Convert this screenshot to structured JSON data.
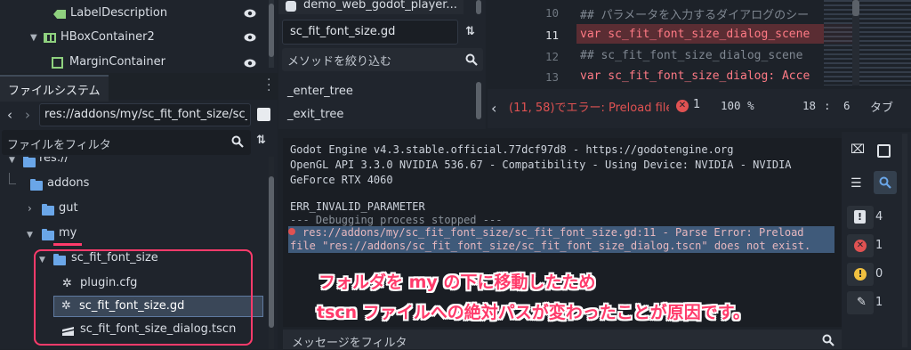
{
  "scene_tree": {
    "rows": [
      {
        "label": "LabelDescription"
      },
      {
        "label": "HBoxContainer2"
      },
      {
        "label": "MarginContainer"
      }
    ]
  },
  "filesystem": {
    "tab_label": "ファイルシステム",
    "path": "res://addons/my/sc_fit_font_size/sc_",
    "filter_placeholder": "ファイルをフィルタ",
    "tree": [
      {
        "label": "res://"
      },
      {
        "label": "addons"
      },
      {
        "label": "gut"
      },
      {
        "label": "my"
      },
      {
        "label": "sc_fit_font_size"
      },
      {
        "label": "plugin.cfg"
      },
      {
        "label": "sc_fit_font_size.gd"
      },
      {
        "label": "sc_fit_font_size_dialog.tscn"
      }
    ]
  },
  "script_list": {
    "top_item": "demo_web_godot_player...",
    "current_script": "sc_fit_font_size.gd",
    "method_filter_placeholder": "メソッドを絞り込む",
    "methods": [
      "_enter_tree",
      "_exit_tree"
    ]
  },
  "editor": {
    "lines": [
      {
        "num": "10",
        "text": "## パラメータを入力するダイアログのシー"
      },
      {
        "num": "11",
        "text": "var sc_fit_font_size_dialog_scene"
      },
      {
        "num": "12",
        "text": "## sc_fit_font_size_dialog_scene"
      },
      {
        "num": "13",
        "text": "var sc_fit_font_size_dialog: Acce"
      }
    ],
    "status": {
      "error_text": "(11, 58)でエラー: Preload file",
      "error_count": "1",
      "zoom": "100 %",
      "line": "18",
      "col": "6",
      "indent": "タブ"
    }
  },
  "output": {
    "lines": [
      "Godot Engine v4.3.stable.official.77dcf97d8 - https://godotengine.org",
      "OpenGL API 3.3.0 NVIDIA 536.67 - Compatibility - Using Device: NVIDIA - NVIDIA",
      "GeForce RTX 4060",
      "",
      "ERR_INVALID_PARAMETER",
      "--- Debugging process stopped ---",
      "res://addons/my/sc_fit_font_size/sc_fit_font_size.gd:11 - Parse Error: Preload",
      "file \"res://addons/sc_fit_font_size/sc_fit_font_size_dialog.tscn\" does not exist."
    ],
    "filter_placeholder": "メッセージをフィルタ",
    "counts": {
      "messages": "4",
      "errors": "1",
      "warnings": "0",
      "editor": "1"
    }
  },
  "annotation": {
    "line1": "フォルダを my の下に移動したため",
    "line2": "tscn ファイルへの絶対パスが変わったことが原因です。"
  },
  "colors": {
    "accent": "#4f8de0",
    "annotation": "#ff3b6b",
    "error": "#e05252",
    "highlight": "#ff3b6b"
  }
}
